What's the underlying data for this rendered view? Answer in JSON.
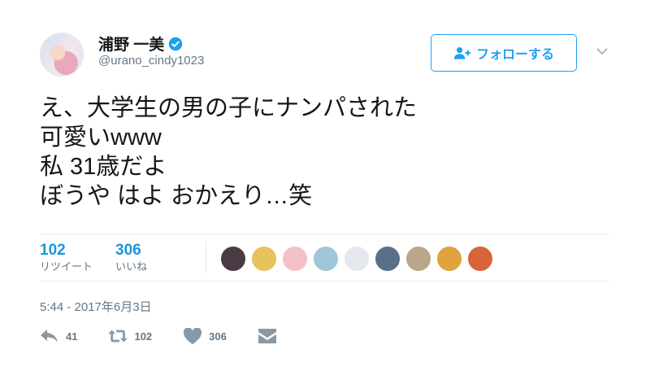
{
  "user": {
    "name": "浦野 一美",
    "handle": "@urano_cindy1023",
    "verified": true
  },
  "follow_button": {
    "label": "フォローする",
    "icon": "add-user-icon"
  },
  "tweet": {
    "text": "え、大学生の男の子にナンパされた\n可愛いwww\n私 31歳だよ\nぼうや はよ おかえり…笑"
  },
  "stats": {
    "retweets": {
      "count": "102",
      "label": "リツイート"
    },
    "likes": {
      "count": "306",
      "label": "いいね"
    }
  },
  "likers": [
    {
      "color": "#4a3b44"
    },
    {
      "color": "#e8c25a"
    },
    {
      "color": "#f3c0c8"
    },
    {
      "color": "#9fc7d9"
    },
    {
      "color": "#e5e9ee"
    },
    {
      "color": "#5a6f8a"
    },
    {
      "color": "#b9a78a"
    },
    {
      "color": "#e0a23c"
    },
    {
      "color": "#d8643a"
    }
  ],
  "timestamp": "5:44 - 2017年6月3日",
  "actions": {
    "reply": "41",
    "retweet": "102",
    "like": "306"
  },
  "colors": {
    "accent": "#1da1f2",
    "stat_number": "#1b95e0",
    "muted": "#657786"
  }
}
